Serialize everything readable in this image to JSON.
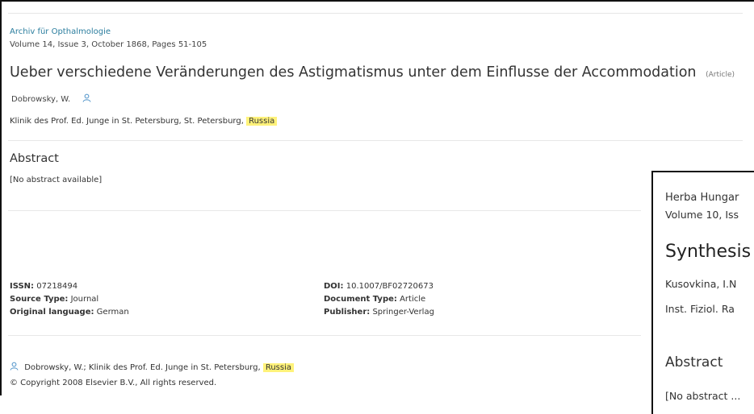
{
  "main": {
    "journal": "Archiv für Opthalmologie",
    "volume_line": "Volume 14, Issue 3, October 1868, Pages 51-105",
    "title": "Ueber verschiedene Veränderungen des Astigmatismus unter dem Einflusse der Accommodation",
    "doc_tag": "(Article)",
    "author": "Dobrowsky, W.",
    "affiliation_prefix": "Klinik des Prof. Ed. Junge in St. Petersburg, St. Petersburg,",
    "affiliation_country": "Russia",
    "abstract_heading": "Abstract",
    "abstract_text": "[No abstract available]",
    "meta_left": [
      {
        "label": "ISSN:",
        "value": "07218494"
      },
      {
        "label": "Source Type:",
        "value": "Journal"
      },
      {
        "label": "Original language:",
        "value": "German"
      }
    ],
    "meta_right": [
      {
        "label": "DOI:",
        "value": "10.1007/BF02720673"
      },
      {
        "label": "Document Type:",
        "value": "Article"
      },
      {
        "label": "Publisher:",
        "value": "Springer-Verlag"
      }
    ],
    "correspondence_prefix": "Dobrowsky, W.; Klinik des Prof. Ed. Junge in St. Petersburg,",
    "correspondence_country": "Russia",
    "copyright": "© Copyright 2008 Elsevier B.V., All rights reserved."
  },
  "overlay": {
    "journal": "Herba Hungar",
    "volume_line": "Volume 10, Iss",
    "title": "Synthesis",
    "author": "Kusovkina, I.N",
    "affiliation": "Inst. Fiziol. Ra",
    "abstract_heading": "Abstract",
    "abstract_text": "[No abstract ..."
  },
  "colors": {
    "link": "#2a7d9e",
    "highlight": "#fff27a",
    "icon": "#4a90c8"
  },
  "icons": {
    "author_icon": "user-icon",
    "correspondence_icon": "user-icon"
  }
}
